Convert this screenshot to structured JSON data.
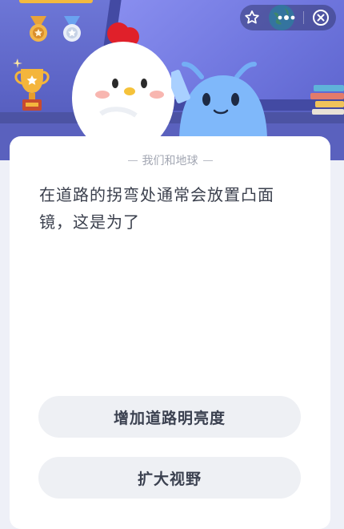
{
  "header": {
    "actions": {
      "favorite_icon": "star-icon",
      "more_icon": "more-dots-icon",
      "close_icon": "close-circle-icon"
    }
  },
  "card": {
    "section_tag": "我们和地球",
    "question": "在道路的拐弯处通常会放置凸面镜，这是为了",
    "options": [
      {
        "label": "增加道路明亮度"
      },
      {
        "label": "扩大视野"
      }
    ]
  },
  "colors": {
    "hero_bg": "#6d76d6",
    "card_bg": "#ffffff",
    "option_bg": "#eef0f4",
    "text_primary": "#3a3f4c"
  }
}
